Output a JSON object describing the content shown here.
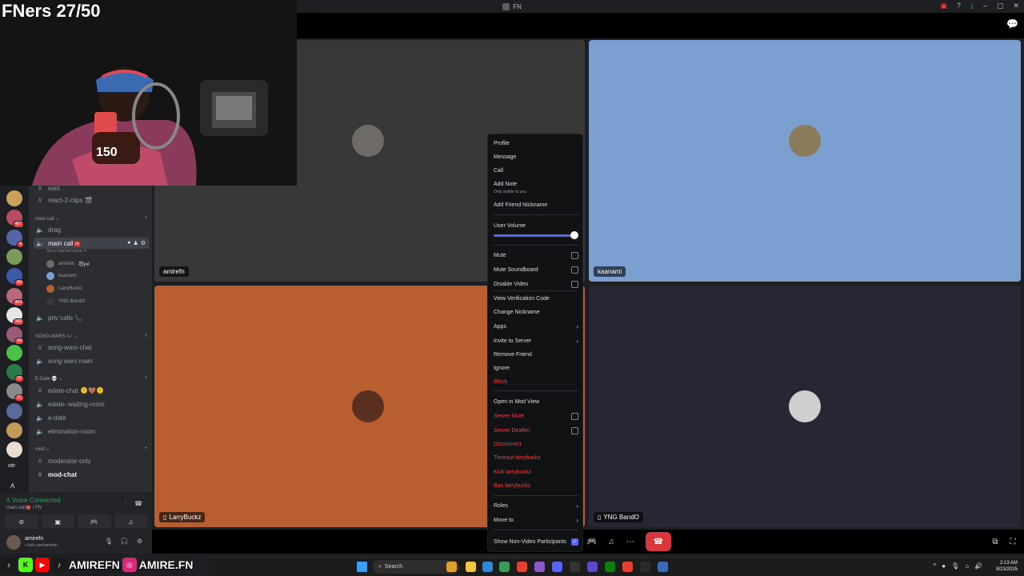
{
  "window": {
    "title": "FN"
  },
  "stream": {
    "title": "FNers 27/50",
    "socials": {
      "handle1": "AMIREFN",
      "handle2": "AMIRE.FN"
    }
  },
  "sidebar": {
    "channels_top": [
      {
        "type": "text",
        "label": "eats"
      },
      {
        "type": "text",
        "label": "react-2-clips 🎬"
      }
    ],
    "cat_main_call": "main call",
    "main_call_channels": [
      {
        "type": "voice",
        "label": "drag"
      },
      {
        "type": "voice",
        "label": "main call☎️"
      }
    ],
    "main_call_status": "Set a channel status",
    "members": [
      "amirefn",
      "kaanami",
      "LarryBuckz",
      "YNG BandO"
    ],
    "member_badge_amirefn": "😈yvl",
    "priv_calls": "priv calls 📞",
    "cat_song_wars": "SONG-WARS 🎶",
    "song_wars": [
      {
        "type": "text",
        "label": "song-wars-chat"
      },
      {
        "type": "voice",
        "label": "song wars main"
      }
    ],
    "cat_edate": "E-Date 💀",
    "edate": [
      {
        "type": "text",
        "label": "edate-chat 🫠🤎🫠"
      },
      {
        "type": "voice",
        "label": "edate- waiting-room"
      },
      {
        "type": "voice",
        "label": "e-date"
      },
      {
        "type": "voice",
        "label": "elimination-room"
      }
    ],
    "cat_mod": "mod",
    "mod": [
      {
        "type": "text",
        "label": "moderator-only"
      },
      {
        "type": "text",
        "label": "mod-chat"
      }
    ],
    "servers": [
      {
        "color": "#c9a15a",
        "badge": ""
      },
      {
        "color": "#b54c64",
        "badge": "467"
      },
      {
        "color": "#5665a8",
        "badge": "4"
      },
      {
        "color": "#7a9a5a",
        "badge": ""
      },
      {
        "color": "#3b5aa8",
        "badge": "84"
      },
      {
        "color": "#b86a7a",
        "badge": "364"
      },
      {
        "color": "#e6e6e6",
        "badge": "160"
      },
      {
        "color": "#9a5a7a",
        "badge": "69"
      },
      {
        "color": "#4ac24a",
        "badge": ""
      },
      {
        "color": "#2a7a4a",
        "badge": "32"
      },
      {
        "color": "#8a8a8a",
        "badge": "21"
      },
      {
        "color": "#5a6a9a",
        "badge": ""
      },
      {
        "color": "#c29a5a",
        "badge": ""
      },
      {
        "color": "#e8ddd0",
        "badge": ""
      }
    ],
    "rail_text_1": "wtr",
    "rail_text_2": "A"
  },
  "voice_panel": {
    "status": "Voice Connected",
    "location": "main call☎️ / FN"
  },
  "user_panel": {
    "name": "amirefn",
    "sub": "• kick.com/amirefn"
  },
  "tiles": [
    {
      "name": "amirefn",
      "bg": "#383838",
      "avatar": "#6e6a66"
    },
    {
      "name": "kaanami",
      "bg": "#7b9fcf",
      "avatar": "#8a7b5a"
    },
    {
      "name": "LarryBuckz",
      "bg": "#b85e30",
      "avatar": "#5a3020"
    },
    {
      "name": "YNG BandO",
      "bg": "#272733",
      "avatar": "#cfcfcf"
    }
  ],
  "context_menu": {
    "profile": "Profile",
    "message": "Message",
    "call": "Call",
    "add_note": "Add Note",
    "add_note_sub": "Only visible to you",
    "add_friend_nickname": "Add Friend Nickname",
    "user_volume": "User Volume",
    "user_volume_value": 1.0,
    "mute": "Mute",
    "mute_soundboard": "Mute Soundboard",
    "disable_video": "Disable Video",
    "view_verification_code": "View Verification Code",
    "change_nickname": "Change Nickname",
    "apps": "Apps",
    "invite_to_server": "Invite to Server",
    "remove_friend": "Remove Friend",
    "ignore": "Ignore",
    "block": "Block",
    "open_in_mod_view": "Open in Mod View",
    "server_mute": "Server Mute",
    "server_deafen": "Server Deafen",
    "disconnect": "Disconnect",
    "timeout": "Timeout larrybuckz",
    "kick": "Kick larrybuckz",
    "ban": "Ban larrybuckz",
    "roles": "Roles",
    "move_to": "Move to",
    "show_non_video": "Show Non-Video Participants",
    "show_non_video_checked": true
  },
  "taskbar": {
    "search_placeholder": "Search",
    "time": "2:13 AM",
    "date": "8/23/2025"
  },
  "colors": {
    "accent": "#5865f2",
    "danger": "#f23f43",
    "online": "#23a55a"
  }
}
